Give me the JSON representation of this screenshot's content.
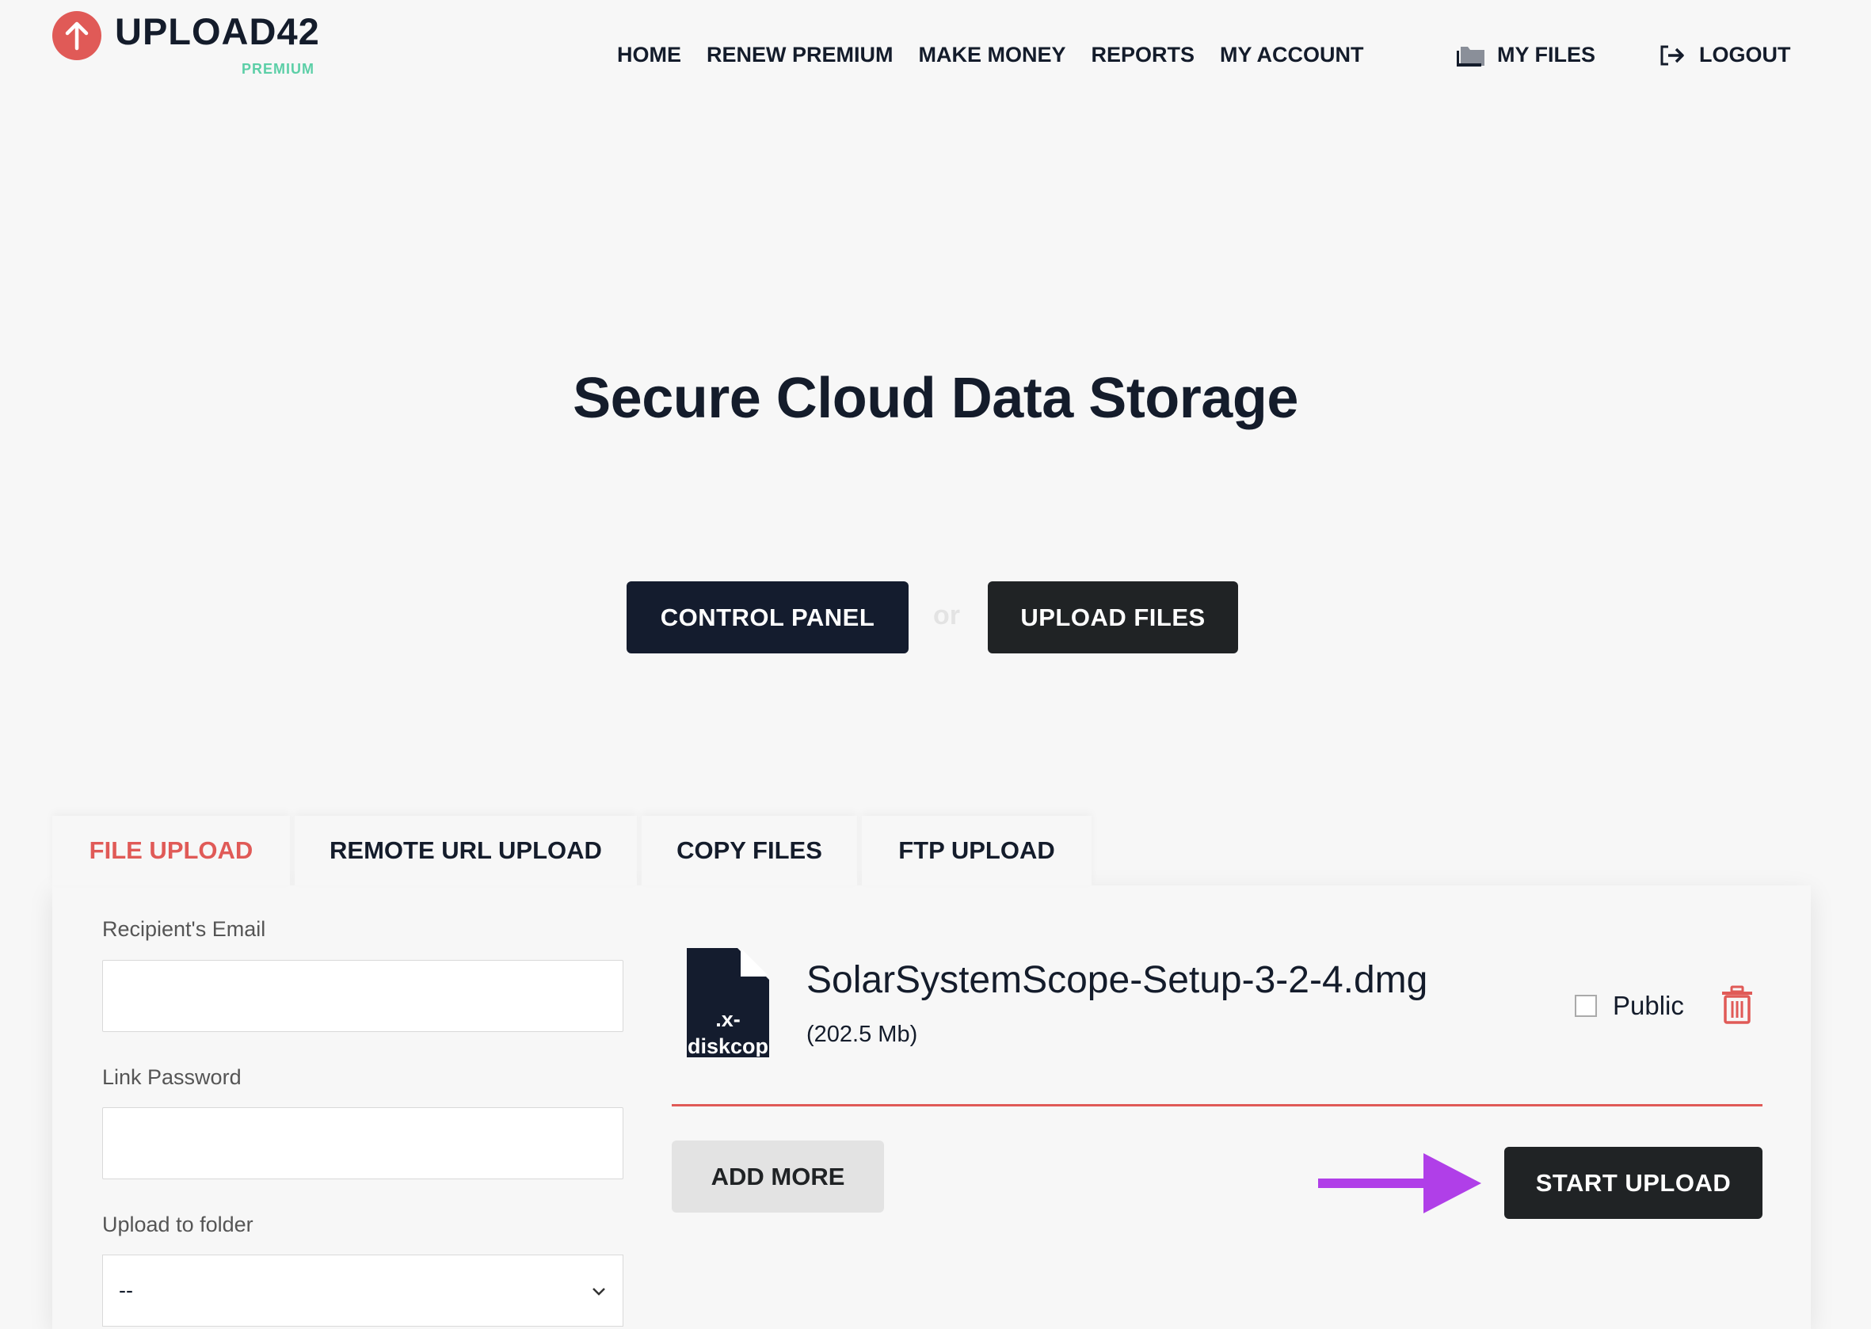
{
  "header": {
    "logo": "UPLOAD42",
    "logo_badge": "PREMIUM",
    "nav": [
      "HOME",
      "RENEW PREMIUM",
      "MAKE MONEY",
      "REPORTS",
      "MY ACCOUNT"
    ],
    "my_files": "MY FILES",
    "logout": "LOGOUT"
  },
  "hero": {
    "title": "Secure Cloud Data Storage",
    "control_panel": "CONTROL PANEL",
    "or": "or",
    "upload_files": "UPLOAD FILES"
  },
  "tabs": [
    {
      "label": "FILE UPLOAD",
      "active": true
    },
    {
      "label": "REMOTE URL UPLOAD",
      "active": false
    },
    {
      "label": "COPY FILES",
      "active": false
    },
    {
      "label": "FTP UPLOAD",
      "active": false
    }
  ],
  "form": {
    "email_label": "Recipient's Email",
    "email_value": "",
    "password_label": "Link Password",
    "password_value": "",
    "folder_label": "Upload to folder",
    "folder_value": "--"
  },
  "file": {
    "ext_label": ".x-diskcop",
    "name": "SolarSystemScope-Setup-3-2-4.dmg",
    "size": "(202.5 Mb)",
    "public_label": "Public",
    "public_checked": false
  },
  "actions": {
    "add_more": "ADD MORE",
    "start_upload": "START UPLOAD"
  },
  "colors": {
    "accent": "#e05a57",
    "dark": "#141c2e",
    "premium": "#5ccfa7",
    "annotation_arrow": "#b03fe8"
  }
}
